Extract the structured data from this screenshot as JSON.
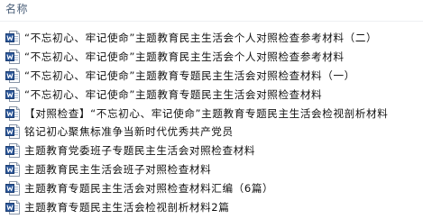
{
  "header": {
    "name_column": "名称"
  },
  "icons": {
    "file_icon": "word-document-icon",
    "icon_blue": "#2b579a",
    "icon_sheet": "#ffffff"
  },
  "files": [
    {
      "name": "“不忘初心、牢记使命”主题教育民主生活会个人对照检查参考材料（二）"
    },
    {
      "name": "“不忘初心、牢记使命”主题教育民主生活会个人对照检查参考材料"
    },
    {
      "name": "“不忘初心、牢记使命”主题教育专题民主生活会对照检查材料（一）"
    },
    {
      "name": "“不忘初心、牢记使命”主题教育专题民主生活会对照检查材料"
    },
    {
      "name": "【对照检查】“不忘初心、牢记使命”主题教育专题民主生活会检视剖析材料"
    },
    {
      "name": "铭记初心聚焦标准争当新时代优秀共产党员"
    },
    {
      "name": "主题教育党委班子专题民主生活会对照检查材料"
    },
    {
      "name": "主题教育民主生活会班子对照检查材料"
    },
    {
      "name": "主题教育专题民主生活会对照检查材料汇编（6篇）"
    },
    {
      "name": "主题教育专题民主生活会检视剖析材料2篇"
    }
  ]
}
